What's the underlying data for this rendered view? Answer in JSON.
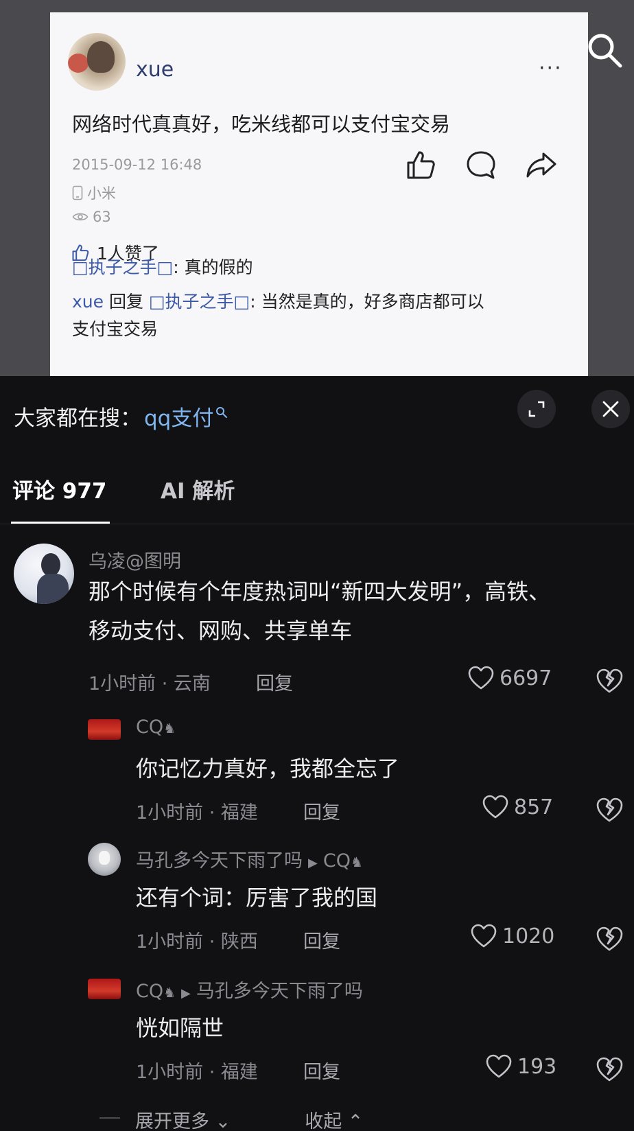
{
  "post": {
    "username": "xue",
    "more_label": "···",
    "text": "网络时代真真好，吃米线都可以支付宝交易",
    "timestamp": "2015-09-12 16:48",
    "device": "小米",
    "views": "63",
    "likes_text": "1人赞了",
    "comments": [
      {
        "author": "□执子之手□",
        "sep": ": ",
        "text": "真的假的"
      },
      {
        "author": "xue",
        "reply_word": " 回复 ",
        "target": "□执子之手□",
        "sep": ": ",
        "text": "当然是真的，好多商店都可以",
        "text2": "支付宝交易"
      }
    ],
    "icons": [
      "thumbs-up-icon",
      "comment-bubble-icon",
      "share-icon",
      "phone-icon",
      "eye-icon",
      "like-small-icon"
    ]
  },
  "hot_search": {
    "label": "大家都在搜：",
    "term": "qq支付"
  },
  "tabs": [
    {
      "label": "评论 977",
      "active": true
    },
    {
      "label": "AI 解析",
      "active": false
    }
  ],
  "comments": [
    {
      "name": "乌凌@图明",
      "text_line1": "那个时候有个年度热词叫“新四大发明”，高铁、",
      "text_line2": "移动支付、网购、共享单车",
      "meta": "1小时前 · 云南",
      "reply": "回复",
      "likes": "6697"
    },
    {
      "name": "CQ",
      "text": "你记忆力真好，我都全忘了",
      "meta": "1小时前 · 福建",
      "reply": "回复",
      "likes": "857"
    },
    {
      "name": "马孔多今天下雨了吗",
      "reply_to": "CQ",
      "text": "还有个词：厉害了我的国",
      "meta": "1小时前 · 陕西",
      "reply": "回复",
      "likes": "1020"
    },
    {
      "name": "CQ",
      "reply_to": "马孔多今天下雨了吗",
      "text": "恍如隔世",
      "meta": "1小时前 · 福建",
      "reply": "回复",
      "likes": "193"
    }
  ],
  "footer": {
    "expand": "展开更多",
    "collapse": "收起"
  },
  "colors": {
    "background": "#111114",
    "hot_term": "#7fb6ef",
    "post_card": "#f7f7f9",
    "blue_name": "#3c5aa8"
  }
}
